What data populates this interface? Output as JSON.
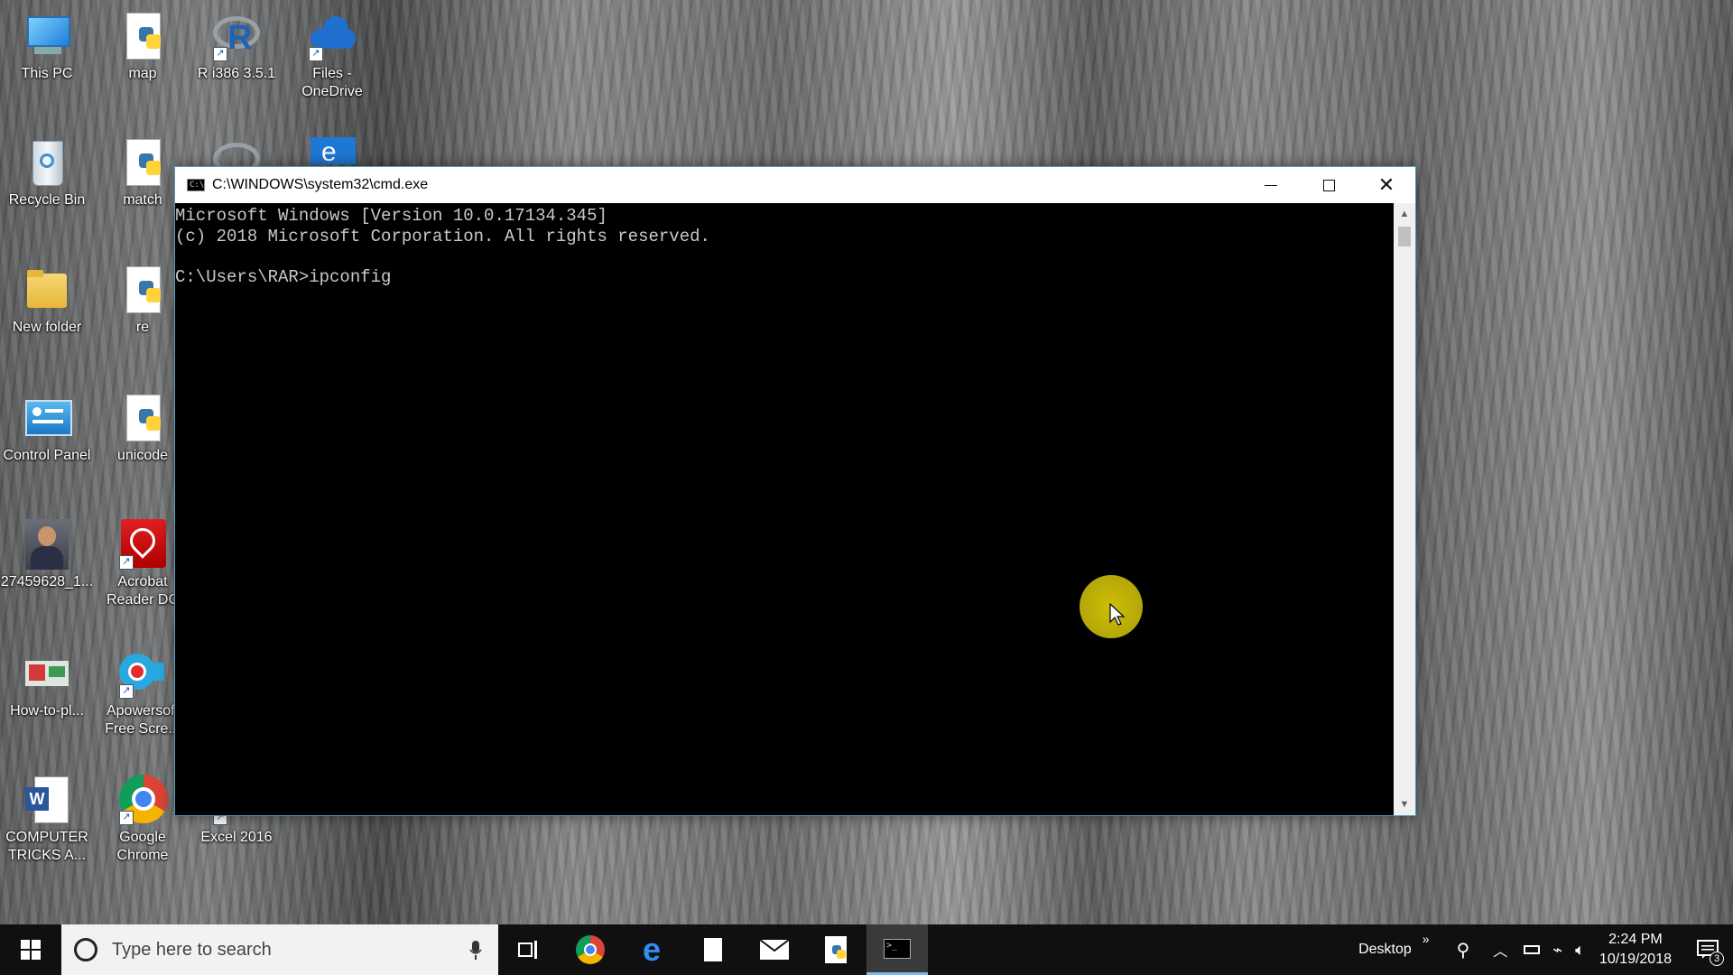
{
  "desktop_icons": [
    {
      "label": "This PC"
    },
    {
      "label": "map"
    },
    {
      "label": "R i386 3.5.1"
    },
    {
      "label": "Files - OneDrive"
    },
    {
      "label": "Recycle Bin"
    },
    {
      "label": "match"
    },
    {
      "label": "New folder"
    },
    {
      "label": "re"
    },
    {
      "label": "Control Panel"
    },
    {
      "label": "unicode"
    },
    {
      "label": "27459628_1..."
    },
    {
      "label": "Acrobat Reader DC"
    },
    {
      "label": "How-to-pl..."
    },
    {
      "label": "Apowersoft Free Scre..."
    },
    {
      "label": "COMPUTER TRICKS A..."
    },
    {
      "label": "Google Chrome"
    },
    {
      "label": "Excel 2016"
    }
  ],
  "cmd_window": {
    "title": "C:\\WINDOWS\\system32\\cmd.exe",
    "lines": [
      "Microsoft Windows [Version 10.0.17134.345]",
      "(c) 2018 Microsoft Corporation. All rights reserved.",
      "",
      "C:\\Users\\RAR>ipconfig"
    ]
  },
  "taskbar": {
    "search_placeholder": "Type here to search",
    "desktop_label": "Desktop",
    "time": "2:24 PM",
    "date": "10/19/2018",
    "notification_count": "3"
  }
}
